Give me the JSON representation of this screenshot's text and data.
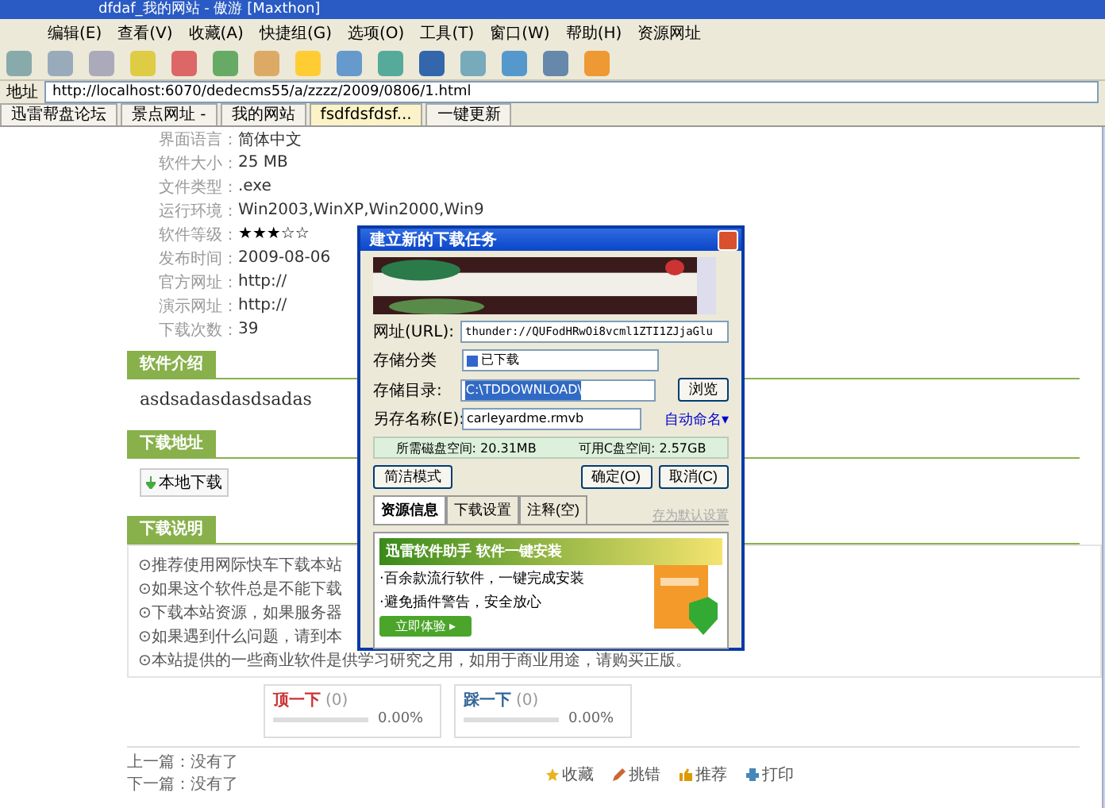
{
  "window": {
    "title": "dfdaf_我的网站 - 傲游 [Maxthon]"
  },
  "menu": [
    "编辑(E)",
    "查看(V)",
    "收藏(A)",
    "快捷组(G)",
    "选项(O)",
    "工具(T)",
    "窗口(W)",
    "帮助(H)",
    "资源网址"
  ],
  "address": {
    "label": "地址",
    "value": "http://localhost:6070/dedecms55/a/zzzz/2009/0806/1.html"
  },
  "tabs": [
    {
      "label": "迅雷帮盘论坛",
      "selected": false
    },
    {
      "label": "景点网址 -",
      "selected": false
    },
    {
      "label": "我的网站",
      "selected": false
    },
    {
      "label": "fsdfdsfdsf...",
      "selected": true
    },
    {
      "label": "一键更新",
      "selected": false
    }
  ],
  "info": [
    {
      "label": "界面语言：",
      "value": "简体中文"
    },
    {
      "label": "软件大小：",
      "value": "25 MB"
    },
    {
      "label": "文件类型：",
      "value": ".exe"
    },
    {
      "label": "运行环境：",
      "value": "Win2003,WinXP,Win2000,Win9"
    },
    {
      "label": "软件等级：",
      "stars": 3
    },
    {
      "label": "发布时间：",
      "value": "2009-08-06"
    },
    {
      "label": "官方网址：",
      "value": "http://"
    },
    {
      "label": "演示网址：",
      "value": "http://"
    },
    {
      "label": "下载次数：",
      "value": "39"
    }
  ],
  "intro": {
    "heading": "软件介绍",
    "text": "asdsadasdasdsadas"
  },
  "download": {
    "heading": "下载地址",
    "button": "本地下载"
  },
  "notes": {
    "heading": "下载说明",
    "lines": [
      "⊙推荐使用网际快车下载本站",
      "⊙如果这个软件总是不能下载",
      "⊙下载本站资源，如果服务器",
      "⊙如果遇到什么问题，请到本",
      "⊙本站提供的一些商业软件是供学习研究之用，如用于商业用途，请购买正版。"
    ]
  },
  "votes": [
    {
      "kind": "up",
      "label": "顶一下",
      "count": "(0)",
      "percent": "0.00%",
      "level": 0
    },
    {
      "kind": "down",
      "label": "踩一下",
      "count": "(0)",
      "percent": "0.00%",
      "level": 0
    }
  ],
  "prev": "上一篇：没有了",
  "next": "下一篇：没有了",
  "actions": [
    {
      "kind": "star",
      "label": "收藏"
    },
    {
      "kind": "pen",
      "label": "挑错"
    },
    {
      "kind": "thumb",
      "label": "推荐"
    },
    {
      "kind": "print",
      "label": "打印"
    }
  ],
  "dialog": {
    "title": "建立新的下载任务",
    "url_label": "网址(URL):",
    "url": "thunder://QUFodHRwOi8vcml1ZTI1ZJjaGlu",
    "category_label": "存储分类",
    "category": "已下载",
    "dir_label": "存储目录:",
    "dir": "C:\\TDDOWNLOAD\\",
    "browse": "浏览",
    "name_label": "另存名称(E):",
    "name": "carleyardme.rmvb",
    "auto_name": "自动命名▾",
    "disk_needed": "所需磁盘空间: 20.31MB",
    "disk_free": "可用C盘空间: 2.57GB",
    "simple": "简洁模式",
    "ok": "确定(O)",
    "cancel": "取消(C)",
    "tabs": [
      {
        "label": "资源信息",
        "selected": true
      },
      {
        "label": "下载设置",
        "selected": false
      },
      {
        "label": "注释(空)",
        "selected": false
      }
    ],
    "save_default": {
      "label": "存为默认设置",
      "disabled": true
    },
    "ad": {
      "title": "迅雷软件助手  软件一键安装",
      "lines": [
        "·百余款流行软件，一键完成安装",
        "·避免插件警告，安全放心"
      ],
      "button": "立即体验 ▸"
    }
  }
}
